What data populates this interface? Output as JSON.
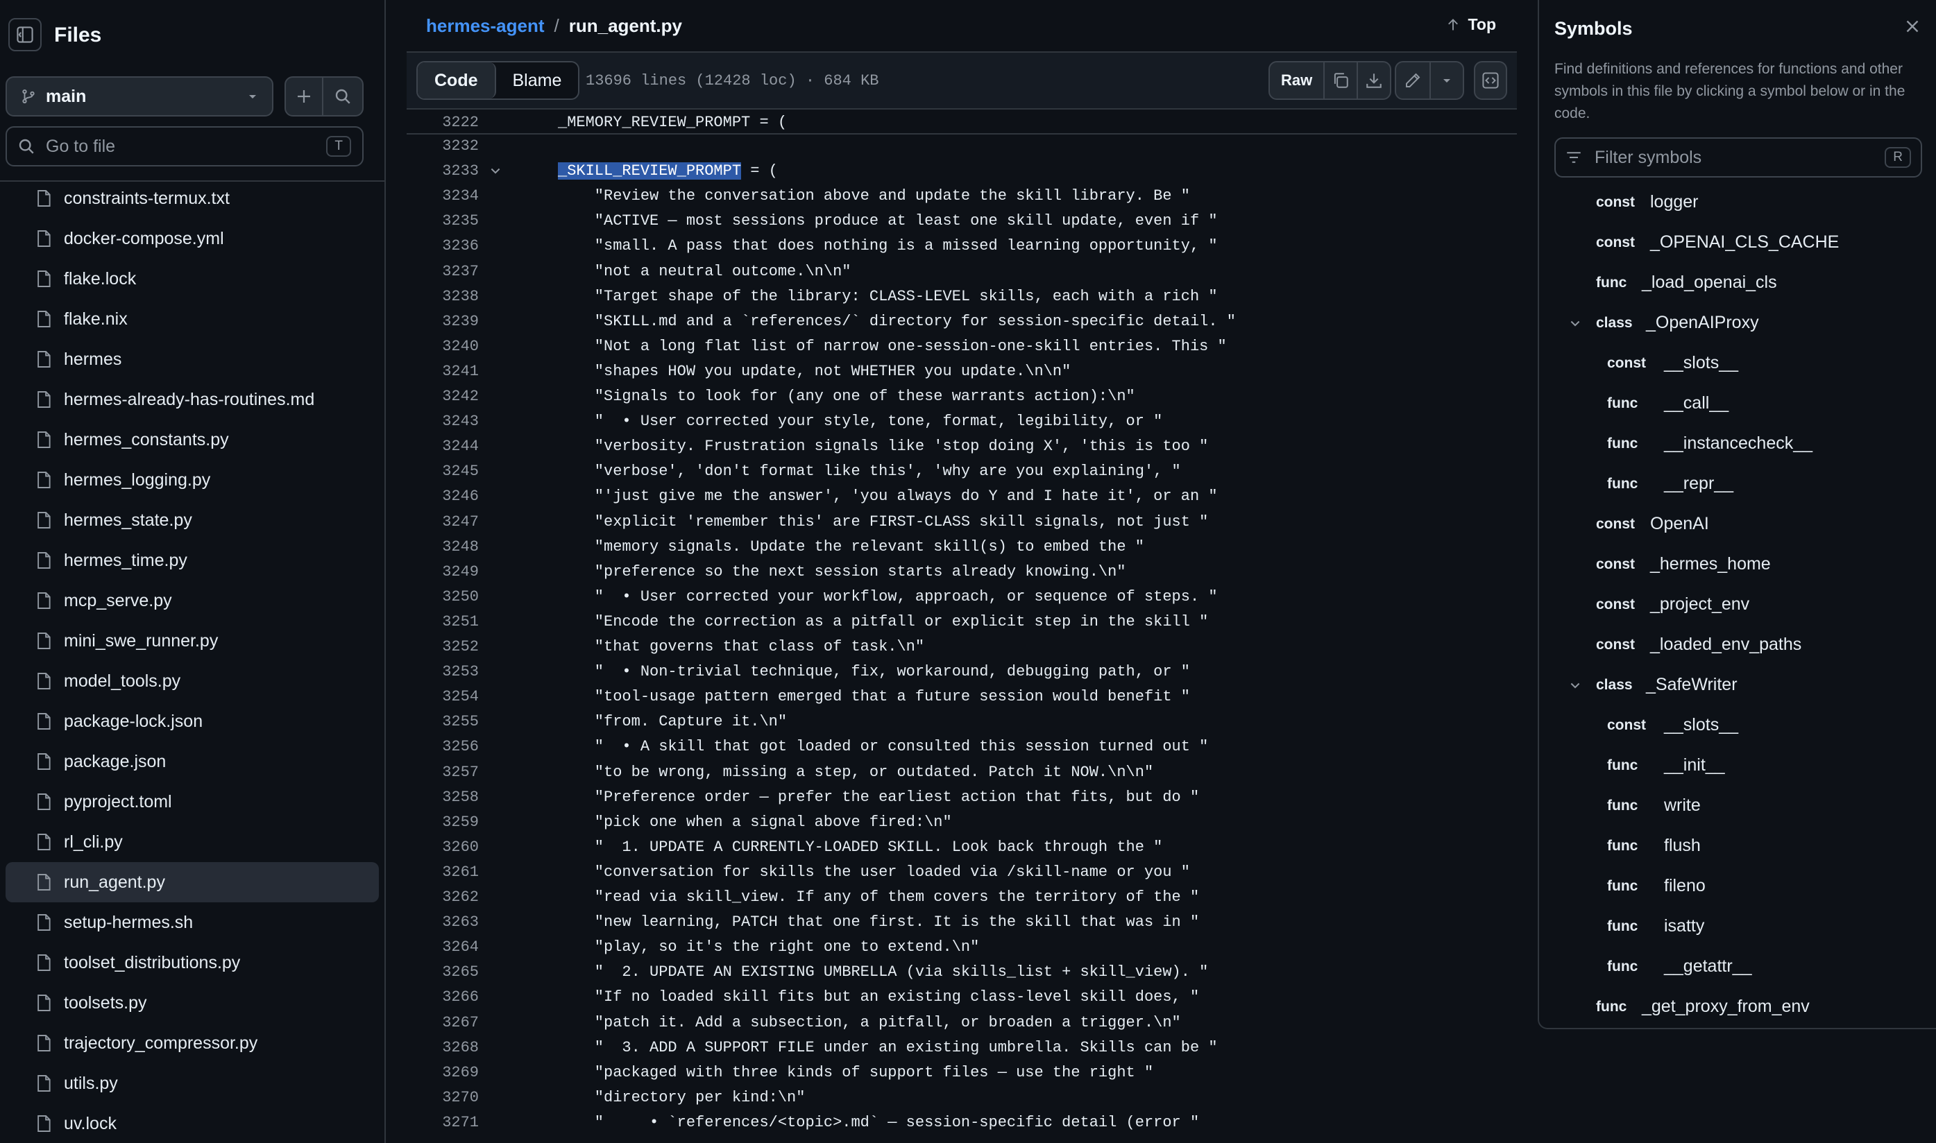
{
  "sidebar": {
    "title": "Files",
    "branch": "main",
    "goto_placeholder": "Go to file",
    "goto_shortcut": "T",
    "files": [
      {
        "name": "constraints-termux.txt"
      },
      {
        "name": "docker-compose.yml"
      },
      {
        "name": "flake.lock"
      },
      {
        "name": "flake.nix"
      },
      {
        "name": "hermes"
      },
      {
        "name": "hermes-already-has-routines.md"
      },
      {
        "name": "hermes_constants.py"
      },
      {
        "name": "hermes_logging.py"
      },
      {
        "name": "hermes_state.py"
      },
      {
        "name": "hermes_time.py"
      },
      {
        "name": "mcp_serve.py"
      },
      {
        "name": "mini_swe_runner.py"
      },
      {
        "name": "model_tools.py"
      },
      {
        "name": "package-lock.json"
      },
      {
        "name": "package.json"
      },
      {
        "name": "pyproject.toml"
      },
      {
        "name": "rl_cli.py"
      },
      {
        "name": "run_agent.py",
        "active": true
      },
      {
        "name": "setup-hermes.sh"
      },
      {
        "name": "toolset_distributions.py"
      },
      {
        "name": "toolsets.py"
      },
      {
        "name": "trajectory_compressor.py"
      },
      {
        "name": "utils.py"
      },
      {
        "name": "uv.lock"
      }
    ]
  },
  "header": {
    "repo": "hermes-agent",
    "separator": "/",
    "file": "run_agent.py",
    "top_label": "Top"
  },
  "toolbar": {
    "code_tab": "Code",
    "blame_tab": "Blame",
    "file_meta": "13696 lines (12428 loc) · 684 KB",
    "raw_label": "Raw"
  },
  "sticky": {
    "num": "3222",
    "text": "_MEMORY_REVIEW_PROMPT = ("
  },
  "code": {
    "highlight": "_SKILL_REVIEW_PROMPT",
    "lines": [
      {
        "num": "3232",
        "text": ""
      },
      {
        "num": "3233",
        "text": " = (",
        "fold": true,
        "has_highlight": true
      },
      {
        "num": "3234",
        "text": "    \"Review the conversation above and update the skill library. Be \""
      },
      {
        "num": "3235",
        "text": "    \"ACTIVE — most sessions produce at least one skill update, even if \""
      },
      {
        "num": "3236",
        "text": "    \"small. A pass that does nothing is a missed learning opportunity, \""
      },
      {
        "num": "3237",
        "text": "    \"not a neutral outcome.\\n\\n\""
      },
      {
        "num": "3238",
        "text": "    \"Target shape of the library: CLASS-LEVEL skills, each with a rich \""
      },
      {
        "num": "3239",
        "text": "    \"SKILL.md and a `references/` directory for session-specific detail. \""
      },
      {
        "num": "3240",
        "text": "    \"Not a long flat list of narrow one-session-one-skill entries. This \""
      },
      {
        "num": "3241",
        "text": "    \"shapes HOW you update, not WHETHER you update.\\n\\n\""
      },
      {
        "num": "3242",
        "text": "    \"Signals to look for (any one of these warrants action):\\n\""
      },
      {
        "num": "3243",
        "text": "    \"  • User corrected your style, tone, format, legibility, or \""
      },
      {
        "num": "3244",
        "text": "    \"verbosity. Frustration signals like 'stop doing X', 'this is too \""
      },
      {
        "num": "3245",
        "text": "    \"verbose', 'don't format like this', 'why are you explaining', \""
      },
      {
        "num": "3246",
        "text": "    \"'just give me the answer', 'you always do Y and I hate it', or an \""
      },
      {
        "num": "3247",
        "text": "    \"explicit 'remember this' are FIRST-CLASS skill signals, not just \""
      },
      {
        "num": "3248",
        "text": "    \"memory signals. Update the relevant skill(s) to embed the \""
      },
      {
        "num": "3249",
        "text": "    \"preference so the next session starts already knowing.\\n\""
      },
      {
        "num": "3250",
        "text": "    \"  • User corrected your workflow, approach, or sequence of steps. \""
      },
      {
        "num": "3251",
        "text": "    \"Encode the correction as a pitfall or explicit step in the skill \""
      },
      {
        "num": "3252",
        "text": "    \"that governs that class of task.\\n\""
      },
      {
        "num": "3253",
        "text": "    \"  • Non-trivial technique, fix, workaround, debugging path, or \""
      },
      {
        "num": "3254",
        "text": "    \"tool-usage pattern emerged that a future session would benefit \""
      },
      {
        "num": "3255",
        "text": "    \"from. Capture it.\\n\""
      },
      {
        "num": "3256",
        "text": "    \"  • A skill that got loaded or consulted this session turned out \""
      },
      {
        "num": "3257",
        "text": "    \"to be wrong, missing a step, or outdated. Patch it NOW.\\n\\n\""
      },
      {
        "num": "3258",
        "text": "    \"Preference order — prefer the earliest action that fits, but do \""
      },
      {
        "num": "3259",
        "text": "    \"pick one when a signal above fired:\\n\""
      },
      {
        "num": "3260",
        "text": "    \"  1. UPDATE A CURRENTLY-LOADED SKILL. Look back through the \""
      },
      {
        "num": "3261",
        "text": "    \"conversation for skills the user loaded via /skill-name or you \""
      },
      {
        "num": "3262",
        "text": "    \"read via skill_view. If any of them covers the territory of the \""
      },
      {
        "num": "3263",
        "text": "    \"new learning, PATCH that one first. It is the skill that was in \""
      },
      {
        "num": "3264",
        "text": "    \"play, so it's the right one to extend.\\n\""
      },
      {
        "num": "3265",
        "text": "    \"  2. UPDATE AN EXISTING UMBRELLA (via skills_list + skill_view). \""
      },
      {
        "num": "3266",
        "text": "    \"If no loaded skill fits but an existing class-level skill does, \""
      },
      {
        "num": "3267",
        "text": "    \"patch it. Add a subsection, a pitfall, or broaden a trigger.\\n\""
      },
      {
        "num": "3268",
        "text": "    \"  3. ADD A SUPPORT FILE under an existing umbrella. Skills can be \""
      },
      {
        "num": "3269",
        "text": "    \"packaged with three kinds of support files — use the right \""
      },
      {
        "num": "3270",
        "text": "    \"directory per kind:\\n\""
      },
      {
        "num": "3271",
        "text": "    \"     • `references/<topic>.md` — session-specific detail (error \""
      }
    ]
  },
  "symbols": {
    "title": "Symbols",
    "description": "Find definitions and references for functions and other symbols in this file by clicking a symbol below or in the code.",
    "filter_placeholder": "Filter symbols",
    "filter_shortcut": "R",
    "items": [
      {
        "kind": "const",
        "name": "logger",
        "depth": 0
      },
      {
        "kind": "const",
        "name": "_OPENAI_CLS_CACHE",
        "depth": 0
      },
      {
        "kind": "func",
        "name": "_load_openai_cls",
        "depth": 0
      },
      {
        "kind": "class",
        "name": "_OpenAIProxy",
        "depth": 0,
        "expanded": true
      },
      {
        "kind": "const",
        "name": "__slots__",
        "depth": 1
      },
      {
        "kind": "func",
        "name": "__call__",
        "depth": 1
      },
      {
        "kind": "func",
        "name": "__instancecheck__",
        "depth": 1
      },
      {
        "kind": "func",
        "name": "__repr__",
        "depth": 1
      },
      {
        "kind": "const",
        "name": "OpenAI",
        "depth": 0
      },
      {
        "kind": "const",
        "name": "_hermes_home",
        "depth": 0
      },
      {
        "kind": "const",
        "name": "_project_env",
        "depth": 0
      },
      {
        "kind": "const",
        "name": "_loaded_env_paths",
        "depth": 0
      },
      {
        "kind": "class",
        "name": "_SafeWriter",
        "depth": 0,
        "expanded": true
      },
      {
        "kind": "const",
        "name": "__slots__",
        "depth": 1
      },
      {
        "kind": "func",
        "name": "__init__",
        "depth": 1
      },
      {
        "kind": "func",
        "name": "write",
        "depth": 1
      },
      {
        "kind": "func",
        "name": "flush",
        "depth": 1
      },
      {
        "kind": "func",
        "name": "fileno",
        "depth": 1
      },
      {
        "kind": "func",
        "name": "isatty",
        "depth": 1
      },
      {
        "kind": "func",
        "name": "__getattr__",
        "depth": 1
      },
      {
        "kind": "func",
        "name": "_get_proxy_from_env",
        "depth": 0
      }
    ]
  },
  "icons": {
    "sidebar_toggle": "sidebar-collapse-icon",
    "branch": "git-branch-icon",
    "file": "file-icon",
    "search": "search-icon",
    "add": "plus-icon",
    "copy": "copy-icon",
    "download": "download-icon",
    "edit": "pencil-icon",
    "symbols_panel": "code-square-icon",
    "close": "x-icon",
    "filter": "filter-icon"
  },
  "colors": {
    "background": "#0d1117",
    "link": "#4493f8",
    "highlight": "#2e5aa8",
    "muted": "#9198a1"
  }
}
